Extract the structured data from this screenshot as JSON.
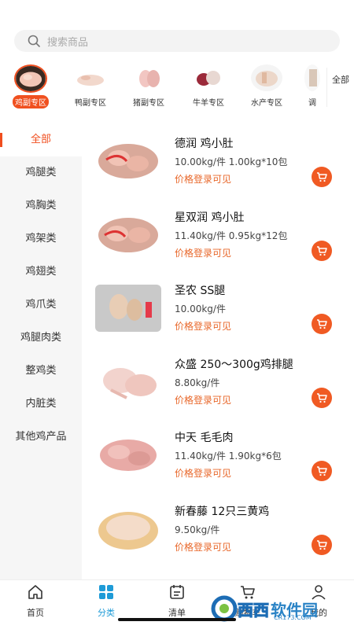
{
  "search": {
    "placeholder": "搜索商品"
  },
  "categories": [
    {
      "label": "鸡副专区",
      "active": true
    },
    {
      "label": "鸭副专区",
      "active": false
    },
    {
      "label": "猪副专区",
      "active": false
    },
    {
      "label": "牛羊专区",
      "active": false
    },
    {
      "label": "水产专区",
      "active": false
    },
    {
      "label": "调",
      "active": false
    }
  ],
  "categories_more": "全部",
  "sidebar": {
    "items": [
      "全部",
      "鸡腿类",
      "鸡胸类",
      "鸡架类",
      "鸡翅类",
      "鸡爪类",
      "鸡腿肉类",
      "整鸡类",
      "内脏类",
      "其他鸡产品"
    ],
    "active_index": 0
  },
  "products": [
    {
      "name": "德润 鸡小肚",
      "spec": "10.00kg/件 1.00kg*10包",
      "price_note": "价格登录可见"
    },
    {
      "name": "星双润 鸡小肚",
      "spec": "11.40kg/件 0.95kg*12包",
      "price_note": "价格登录可见"
    },
    {
      "name": "圣农 SS腿",
      "spec": "10.00kg/件",
      "price_note": "价格登录可见"
    },
    {
      "name": "众盛 250～300g鸡排腿",
      "spec": "8.80kg/件",
      "price_note": "价格登录可见"
    },
    {
      "name": "中天 毛毛肉",
      "spec": "11.40kg/件 1.90kg*6包",
      "price_note": "价格登录可见"
    },
    {
      "name": "新春藤 12只三黄鸡",
      "spec": "9.50kg/件",
      "price_note": "价格登录可见"
    }
  ],
  "tabbar": {
    "home": "首页",
    "category": "分类",
    "list": "清单",
    "cart": "购物车",
    "mine": "我的"
  },
  "watermark": {
    "w1": "西西",
    "w2": "软件园",
    "w3": "CR173.COM"
  },
  "colors": {
    "accent": "#f04e1e",
    "tab_active": "#1e9bd7",
    "price": "#e8672a"
  }
}
